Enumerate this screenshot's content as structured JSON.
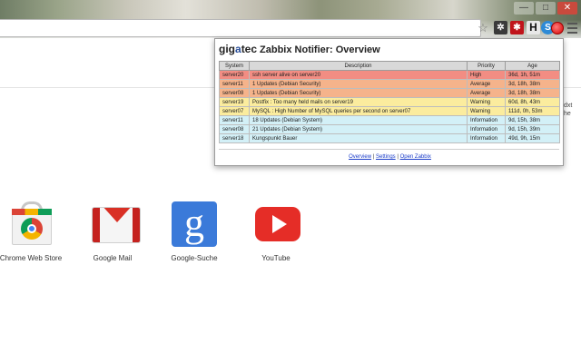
{
  "browser": {
    "window_controls": [
      "—",
      "□",
      "✕"
    ],
    "star_glyph": "☆",
    "extensions": [
      {
        "name": "puzzle-extension-icon",
        "glyph": "✲"
      },
      {
        "name": "lastpass-extension-icon",
        "glyph": "✱"
      },
      {
        "name": "h-extension-icon",
        "glyph": "H"
      },
      {
        "name": "skype-extension-icon",
        "glyph": "S"
      },
      {
        "name": "zabbix-notifier-extension-icon",
        "glyph": ""
      }
    ]
  },
  "popup": {
    "logo_left": "gig",
    "logo_arrow": "a",
    "logo_right": "tec",
    "title": "Zabbix Notifier: Overview",
    "columns": [
      "System",
      "Description",
      "Priority",
      "Age"
    ],
    "rows": [
      {
        "system": "server20",
        "description": "ssh server alive on server20",
        "priority": "High",
        "age": "36d, 1h, 51m",
        "severity": "high"
      },
      {
        "system": "server11",
        "description": "1 Updates (Debian Security)",
        "priority": "Average",
        "age": "3d, 18h, 38m",
        "severity": "average"
      },
      {
        "system": "server08",
        "description": "1 Updates (Debian Security)",
        "priority": "Average",
        "age": "3d, 18h, 38m",
        "severity": "average"
      },
      {
        "system": "server19",
        "description": "Postfix : Too many held mails on server19",
        "priority": "Warning",
        "age": "60d, 8h, 43m",
        "severity": "warning"
      },
      {
        "system": "server07",
        "description": "MySQL : High Number of MySQL queries per second on server07",
        "priority": "Warning",
        "age": "111d, 0h, 53m",
        "severity": "warning"
      },
      {
        "system": "server11",
        "description": "18 Updates (Debian System)",
        "priority": "Information",
        "age": "9d, 15h, 38m",
        "severity": "information"
      },
      {
        "system": "server08",
        "description": "21 Updates (Debian System)",
        "priority": "Information",
        "age": "9d, 15h, 39m",
        "severity": "information"
      },
      {
        "system": "server18",
        "description": "Kungspunkt Bauer",
        "priority": "Information",
        "age": "49d, 9h, 15m",
        "severity": "information"
      }
    ],
    "links": {
      "overview": "Overview",
      "separator": "|",
      "settings": "Settings",
      "open_zabbix": "Open Zabbix"
    }
  },
  "apps": [
    {
      "label": "Chrome Web Store"
    },
    {
      "label": "Google Mail"
    },
    {
      "label": "Google-Suche"
    },
    {
      "label": "YouTube"
    }
  ],
  "google_glyph": "g",
  "edge_text": "dxt\nhe"
}
